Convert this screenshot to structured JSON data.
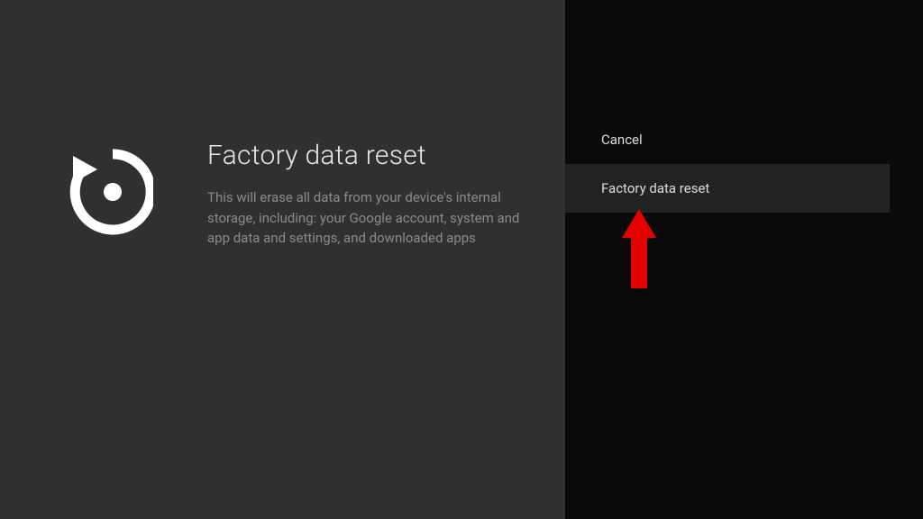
{
  "main": {
    "title": "Factory data reset",
    "description": "This will erase all data from your device's internal storage, including: your Google account, system and app data and settings, and downloaded apps"
  },
  "menu": {
    "cancel_label": "Cancel",
    "reset_label": "Factory data reset"
  }
}
